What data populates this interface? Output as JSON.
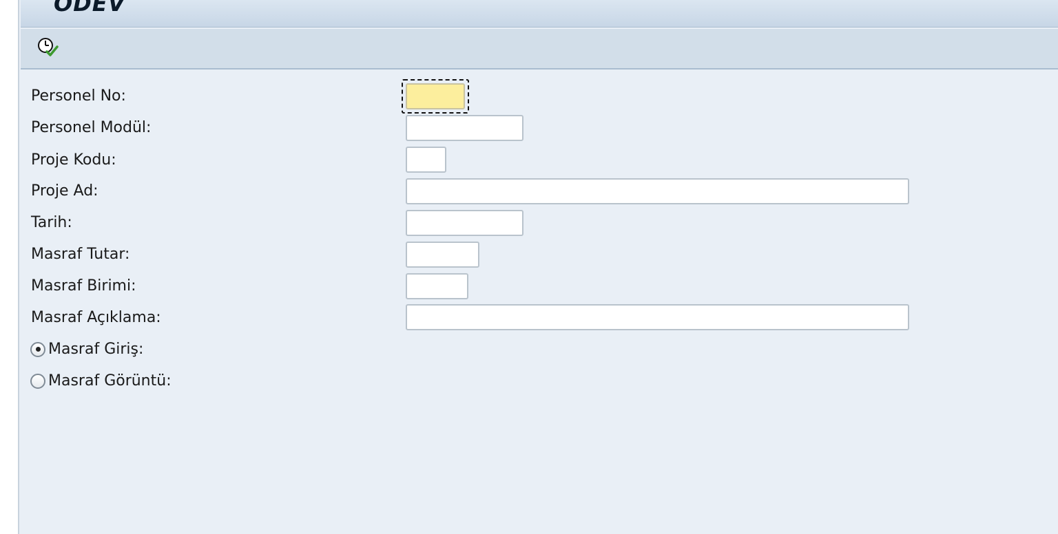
{
  "window": {
    "title": "ODEV"
  },
  "toolbar": {
    "execute_icon": "execute-clock-check-icon"
  },
  "form": {
    "fields": [
      {
        "label": "Personel No:",
        "value": ""
      },
      {
        "label": "Personel Modül:",
        "value": ""
      },
      {
        "label": "Proje Kodu:",
        "value": ""
      },
      {
        "label": "Proje Ad:",
        "value": ""
      },
      {
        "label": "Tarih:",
        "value": ""
      },
      {
        "label": "Masraf Tutar:",
        "value": ""
      },
      {
        "label": "Masraf Birimi:",
        "value": ""
      },
      {
        "label": "Masraf Açıklama:",
        "value": ""
      }
    ],
    "radios": [
      {
        "label": "Masraf Giriş:",
        "selected": true
      },
      {
        "label": "Masraf Görüntü:",
        "selected": false
      }
    ]
  },
  "colors": {
    "background": "#e9eff6",
    "toolbar": "#d2dee9",
    "focused_field": "#fcee9d"
  }
}
